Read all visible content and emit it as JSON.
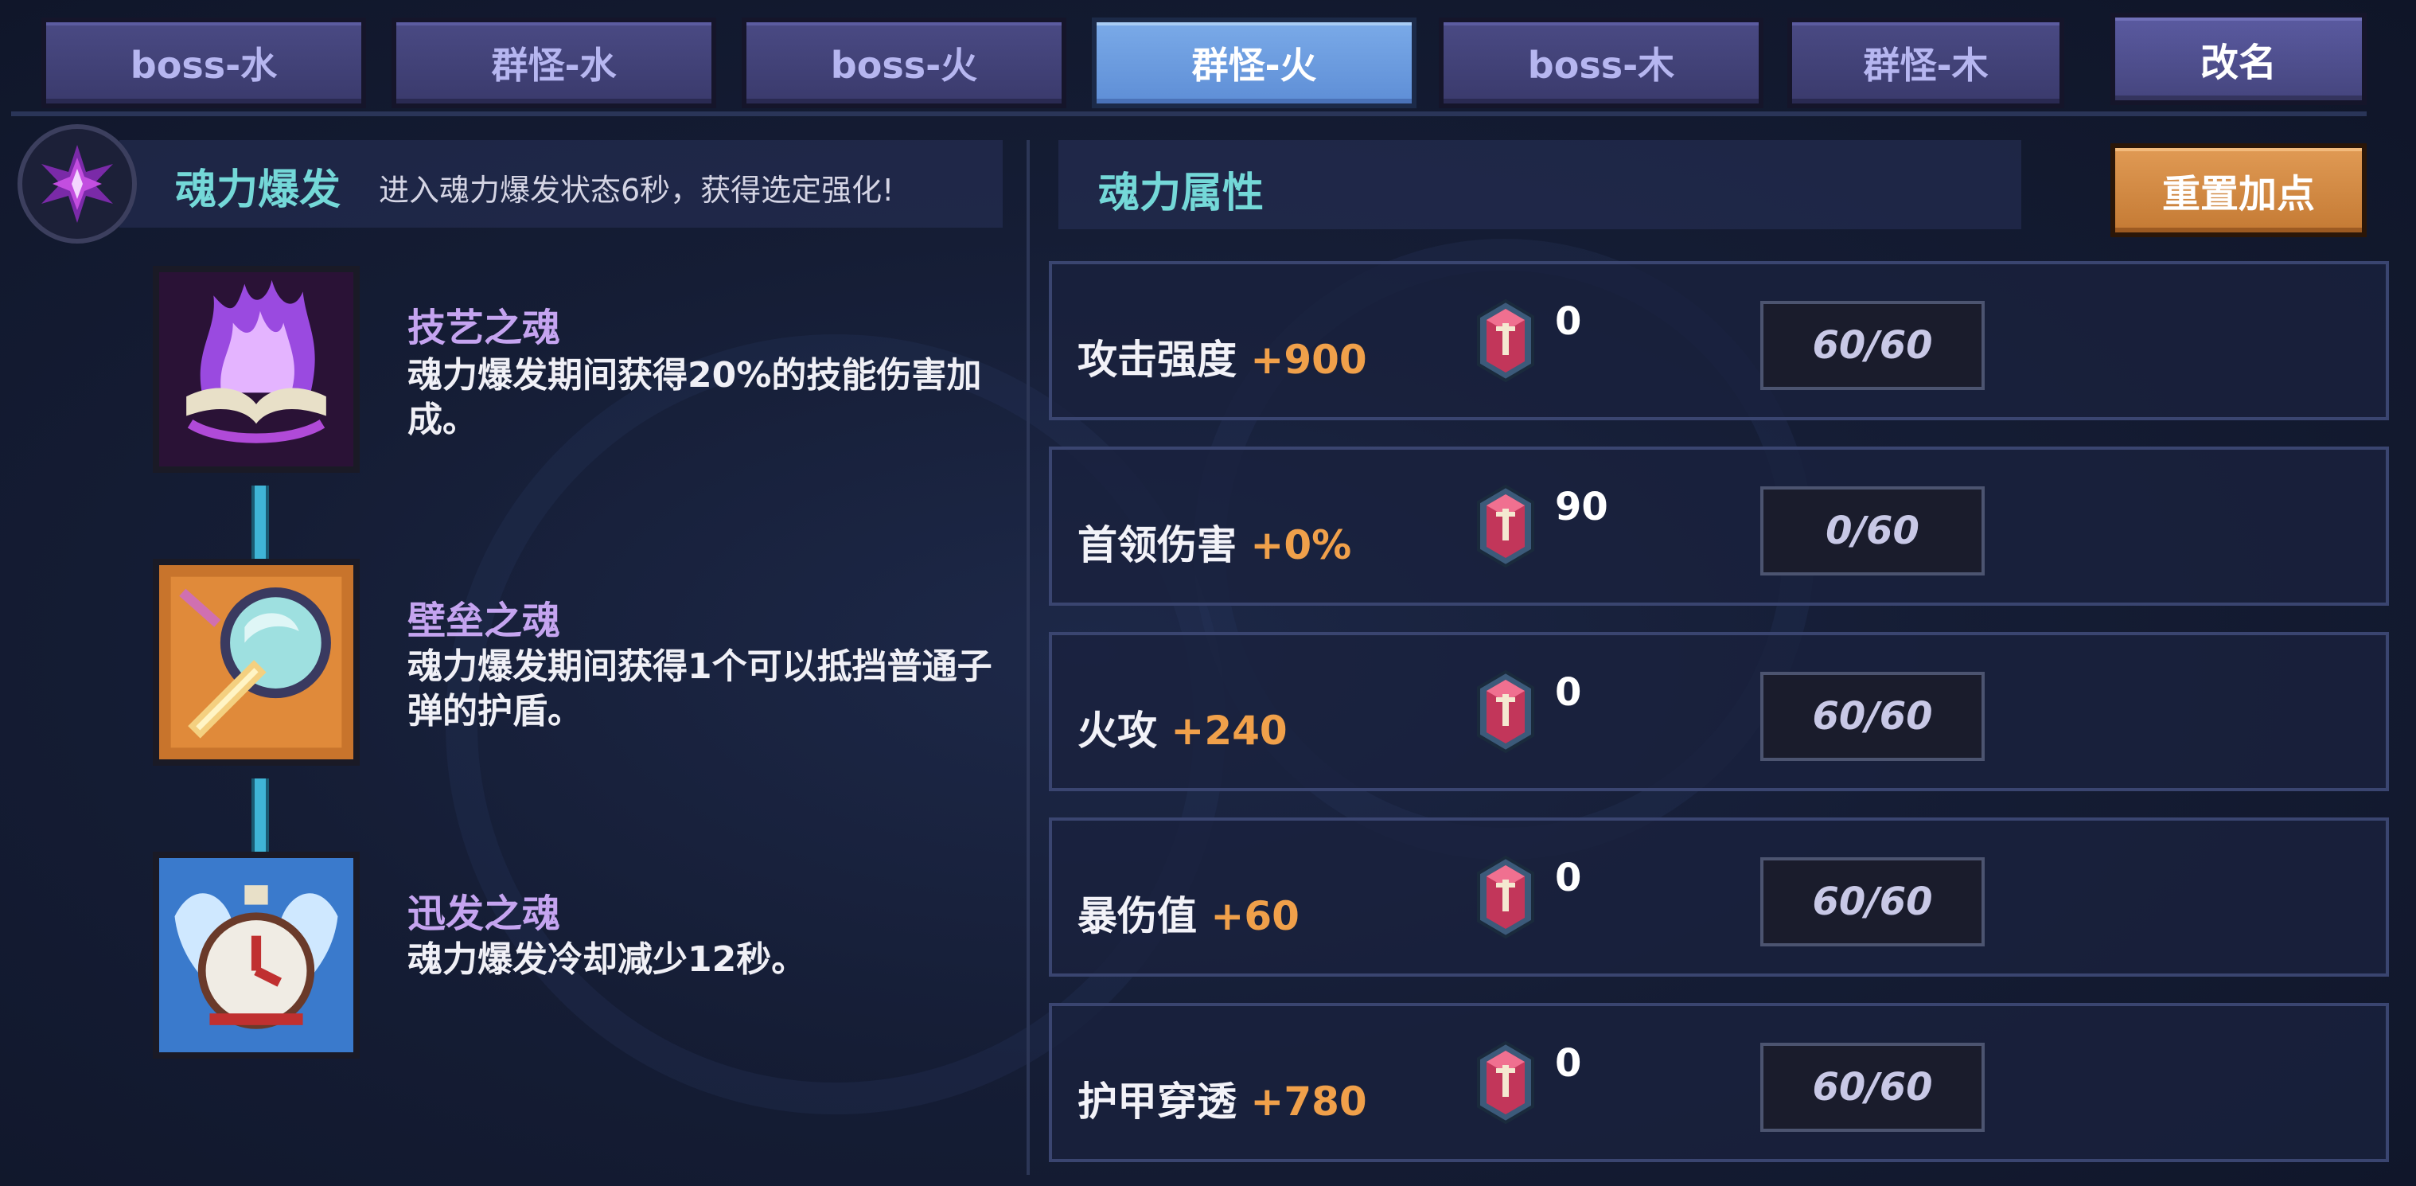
{
  "tabs": [
    {
      "label": "boss-水"
    },
    {
      "label": "群怪-水"
    },
    {
      "label": "boss-火"
    },
    {
      "label": "群怪-火",
      "active": true
    },
    {
      "label": "boss-木"
    },
    {
      "label": "群怪-木"
    }
  ],
  "rename_label": "改名",
  "burst": {
    "title": "魂力爆发",
    "description": "进入魂力爆发状态6秒，获得选定强化!"
  },
  "skills": [
    {
      "name": "技艺之魂",
      "description": "魂力爆发期间获得20%的技能伤害加成。"
    },
    {
      "name": "壁垒之魂",
      "description": "魂力爆发期间获得1个可以抵挡普通子弹的护盾。"
    },
    {
      "name": "迅发之魂",
      "description": "魂力爆发冷却减少12秒。"
    }
  ],
  "attributes": {
    "title": "魂力属性",
    "reset_label": "重置加点",
    "items": [
      {
        "name": "攻击强度",
        "bonus": "+900",
        "count": "0",
        "progress": "60/60"
      },
      {
        "name": "首领伤害",
        "bonus": "+0%",
        "count": "90",
        "progress": "0/60"
      },
      {
        "name": "火攻",
        "bonus": "+240",
        "count": "0",
        "progress": "60/60"
      },
      {
        "name": "暴伤值",
        "bonus": "+60",
        "count": "0",
        "progress": "60/60"
      },
      {
        "name": "护甲穿透",
        "bonus": "+780",
        "count": "0",
        "progress": "60/60"
      }
    ]
  },
  "colors": {
    "active_tab": "#6a9ae0",
    "tab": "#44447a",
    "accent_cyan": "#74d8d8",
    "bonus_orange": "#f0a04a",
    "reset_button": "#d68a44",
    "skill_name": "#c5a4f0"
  },
  "icons": {
    "burst_emblem": "purple-crystal-emblem-icon",
    "skill_1": "purple-flame-tome-icon",
    "skill_2": "orange-shield-axe-icon",
    "skill_3": "winged-clock-icon",
    "gem": "red-crystal-gem-icon"
  }
}
